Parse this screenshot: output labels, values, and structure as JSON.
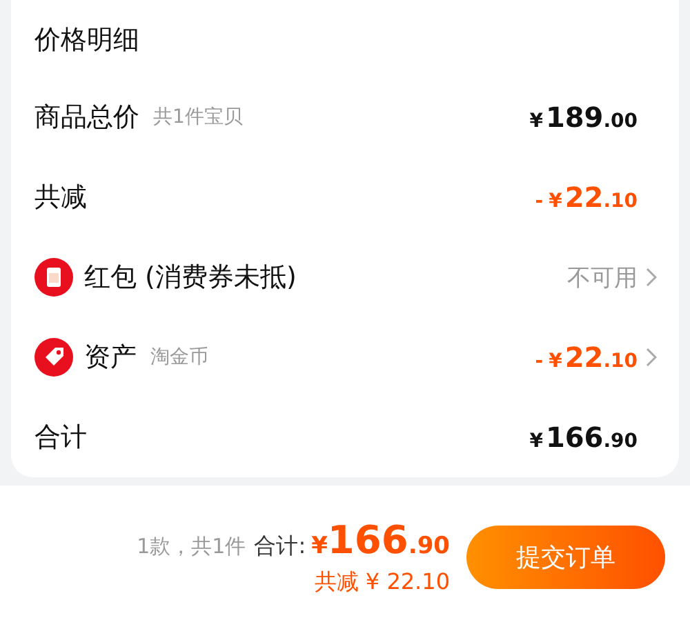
{
  "card": {
    "title": "价格明细",
    "rows": [
      {
        "kind": "plain",
        "label": "商品总价",
        "note": "共1件宝贝",
        "price": {
          "currency": "¥",
          "integer": "189",
          "decimal": ".00",
          "color": "#111111"
        },
        "chevron": false
      },
      {
        "kind": "plain",
        "label": "共减",
        "price": {
          "sign": "-",
          "currency": "¥",
          "integer": "22",
          "decimal": ".10",
          "color": "#ff5000"
        },
        "chevron": false
      },
      {
        "kind": "redpacket",
        "label": "红包 (消费券未抵)",
        "value": "不可用",
        "chevron": true
      },
      {
        "kind": "asset",
        "label": "资产",
        "note": "淘金币",
        "price": {
          "sign": "-",
          "currency": "¥",
          "integer": "22",
          "decimal": ".10",
          "color": "#ff5000"
        },
        "chevron": true
      },
      {
        "kind": "plain",
        "label": "合计",
        "price": {
          "currency": "¥",
          "integer": "166",
          "decimal": ".90",
          "color": "#111111"
        },
        "chevron": false
      }
    ]
  },
  "footer": {
    "count": "1款，共1件",
    "total_label": "合计:",
    "total": {
      "currency": "¥",
      "integer": "166",
      "decimal": ".90"
    },
    "discount": "共减 ¥ 22.10",
    "submit": "提交订单"
  }
}
